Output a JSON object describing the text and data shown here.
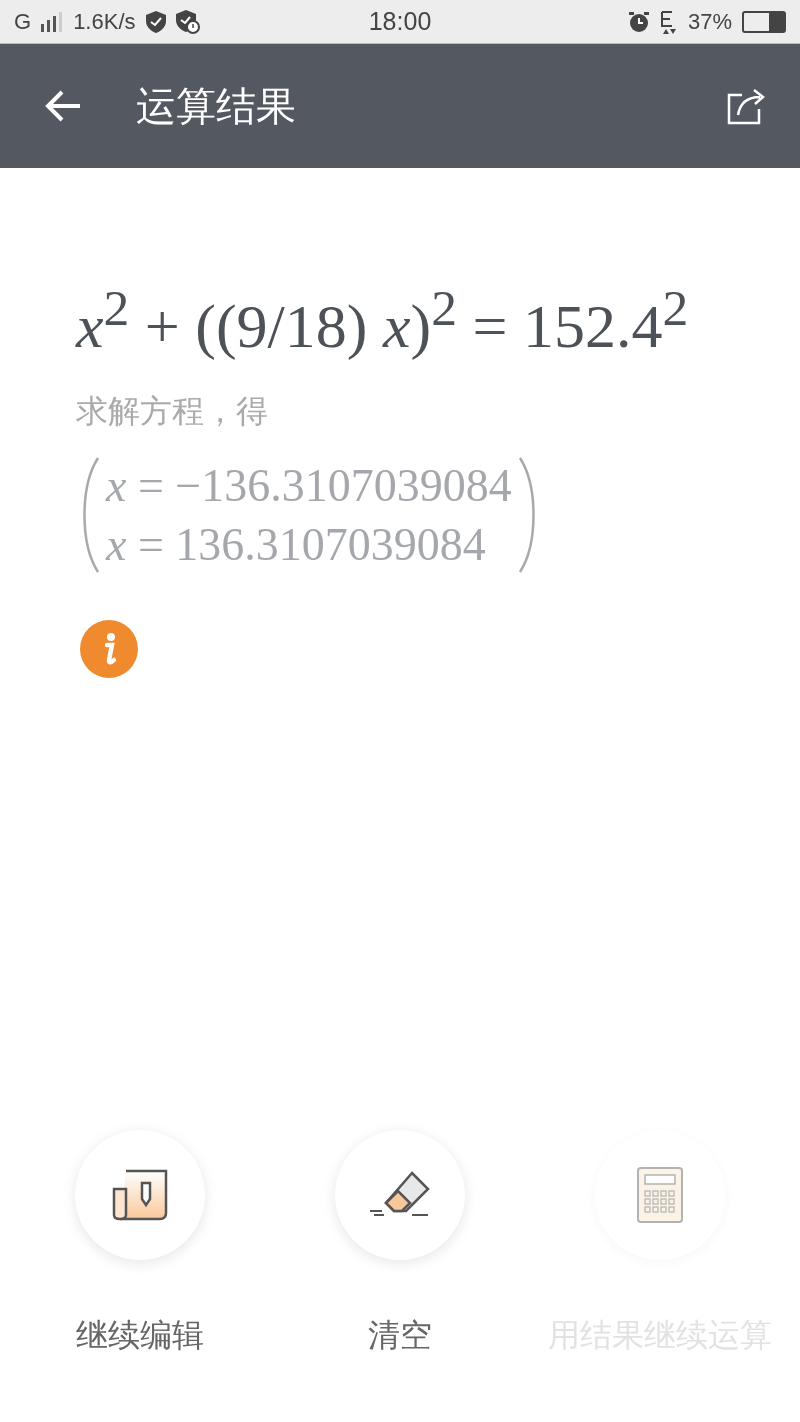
{
  "status_bar": {
    "network": "G",
    "speed": "1.6K/s",
    "time": "18:00",
    "battery": "37%"
  },
  "app_bar": {
    "title": "运算结果"
  },
  "equation": "*x*$^{2}$ + ((9/18) *x*)$^{2}$ = 152.4$^{2}$",
  "caption": "求解方程，得",
  "solutions": [
    "*x* = −136.3107039084",
    "*x* = 136.3107039084"
  ],
  "actions": [
    {
      "label": "继续编辑",
      "kind": "document",
      "disabled": false
    },
    {
      "label": "清空",
      "kind": "eraser",
      "disabled": false
    },
    {
      "label": "用结果继续运算",
      "kind": "calculator",
      "disabled": true
    }
  ]
}
